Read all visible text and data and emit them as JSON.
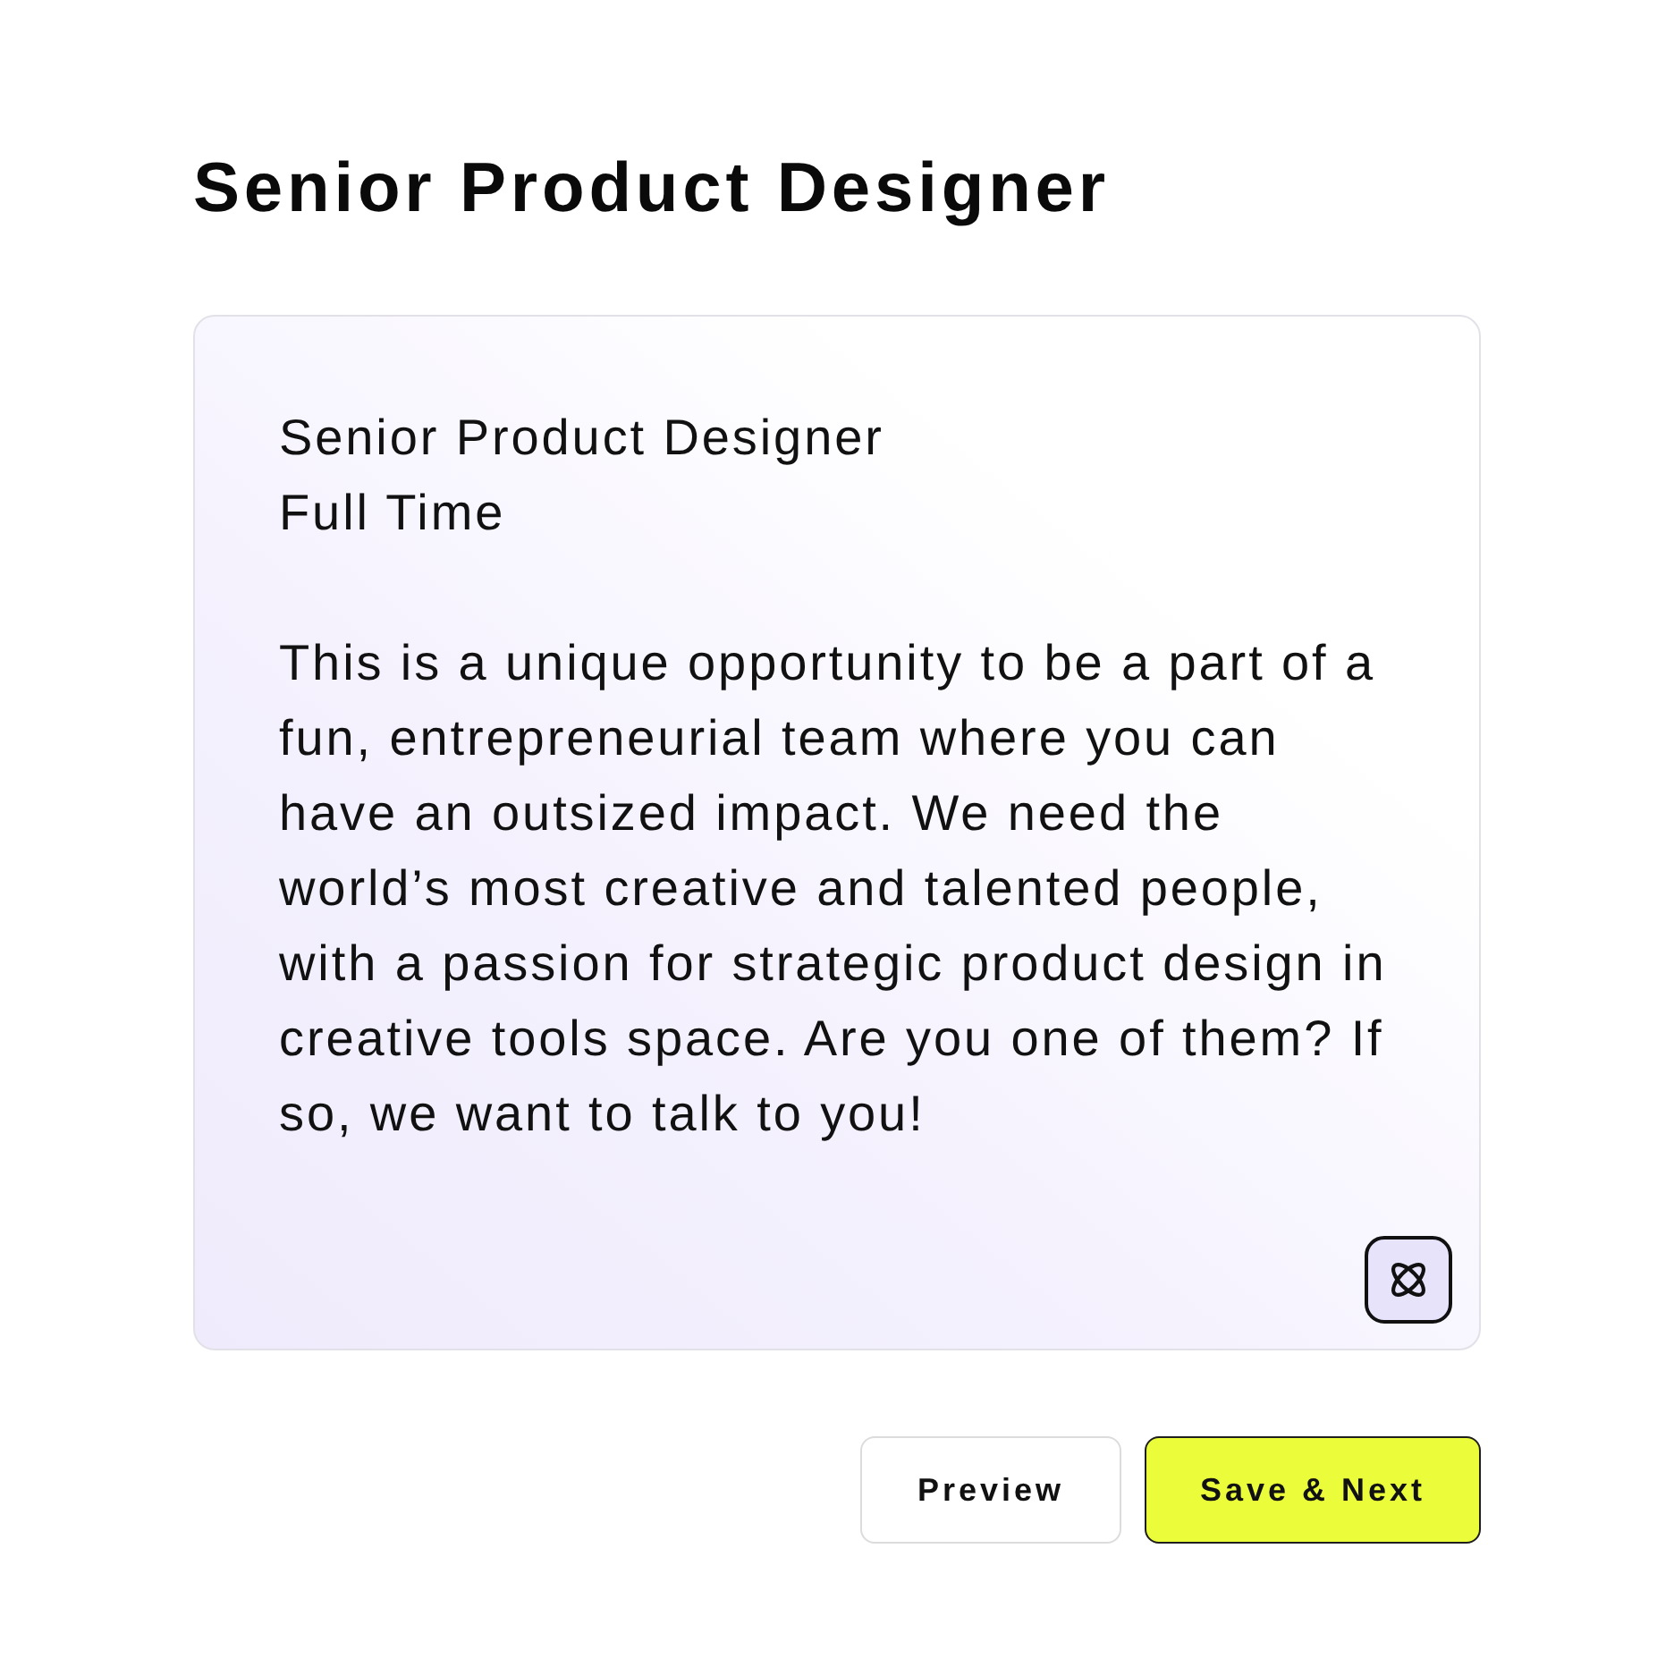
{
  "page": {
    "title": "Senior Product Designer"
  },
  "description": {
    "lines": [
      "Senior Product Designer",
      "Full Time"
    ],
    "body": "This is a unique opportunity to be a part of a fun, entrepreneurial team where you can have an outsized impact. We need the world’s most creative and talented people, with a passion for strategic product design in creative tools space. Are you one of them? If so, we want to talk to you!"
  },
  "buttons": [
    {
      "label": "Preview",
      "kind": "secondary"
    },
    {
      "label": "Save & Next",
      "kind": "primary"
    }
  ]
}
